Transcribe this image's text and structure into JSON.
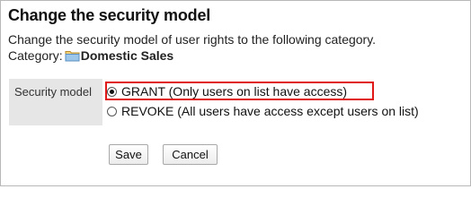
{
  "title": "Change the security model",
  "description": "Change the security model of user rights to the following category.",
  "category": {
    "label": "Category:",
    "name": "Domestic Sales",
    "icon": "folder-icon"
  },
  "security_model": {
    "label": "Security model",
    "options": [
      {
        "label": "GRANT (Only users on list have access)",
        "selected": true
      },
      {
        "label": "REVOKE (All users have access except users on list)",
        "selected": false
      }
    ]
  },
  "buttons": {
    "save": "Save",
    "cancel": "Cancel"
  },
  "colors": {
    "highlight": "#e01818",
    "label_bg": "#e6e6e6"
  }
}
